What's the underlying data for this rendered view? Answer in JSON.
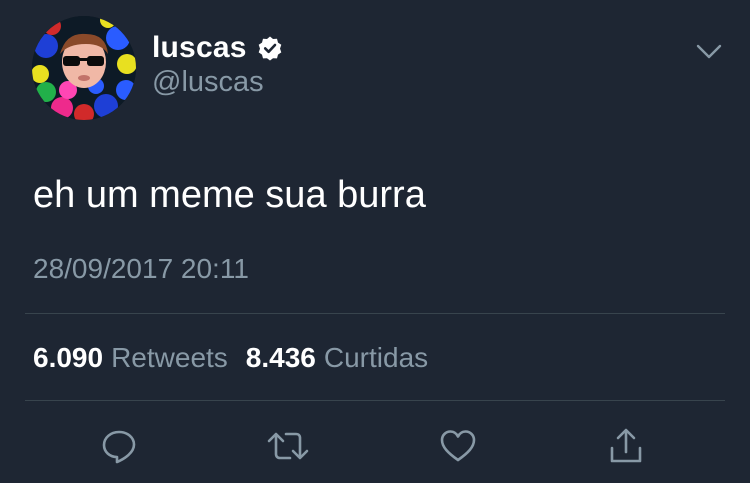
{
  "tweet": {
    "author_name": "luscas",
    "author_handle": "@luscas",
    "verified": true,
    "text": "eh um meme sua burra",
    "timestamp": "28/09/2017 20:11"
  },
  "stats": {
    "retweets_count": "6.090",
    "retweets_label": "Retweets",
    "likes_count": "8.436",
    "likes_label": "Curtidas"
  },
  "actions": [
    {
      "icon": "reply-icon"
    },
    {
      "icon": "retweet-icon"
    },
    {
      "icon": "like-icon"
    },
    {
      "icon": "share-icon"
    }
  ],
  "colors": {
    "background": "#1e2633",
    "text_primary": "#ffffff",
    "text_secondary": "#8899a6",
    "divider": "#38444d",
    "verified_badge": "#ffffff"
  }
}
